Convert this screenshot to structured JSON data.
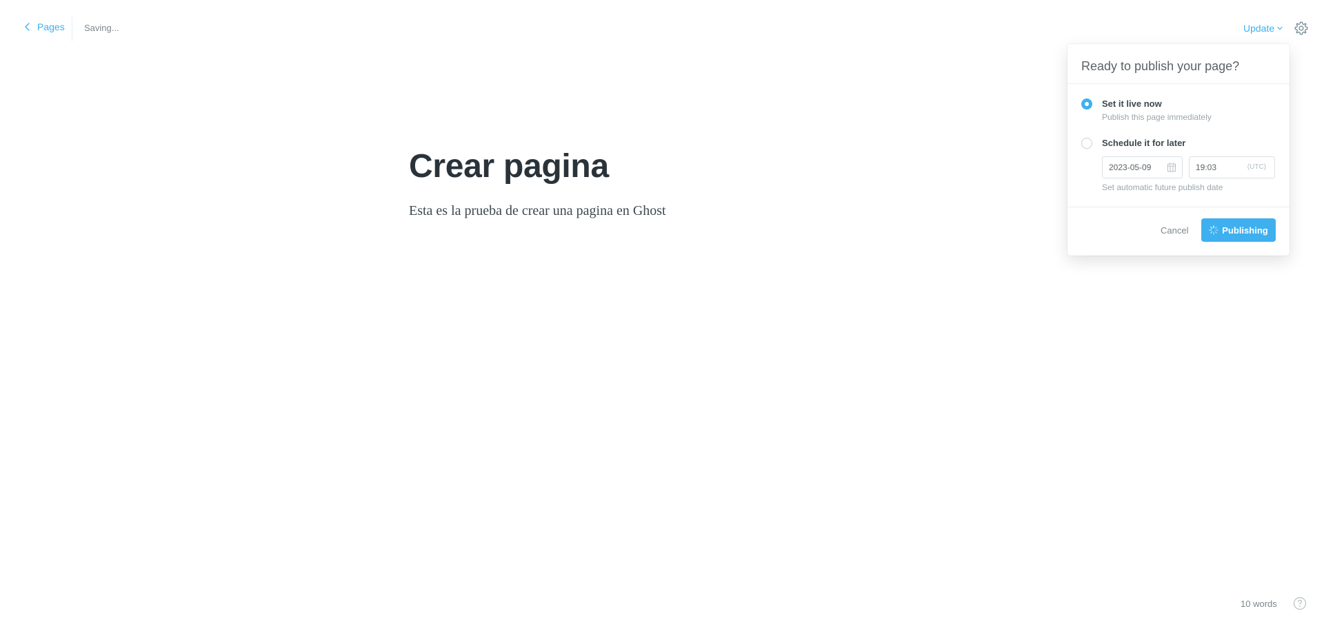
{
  "topbar": {
    "back_label": "Pages",
    "status": "Saving...",
    "update_label": "Update"
  },
  "editor": {
    "title": "Crear pagina",
    "body": "Esta es la prueba de crear una pagina en Ghost"
  },
  "publish_menu": {
    "header": "Ready to publish your page?",
    "options": [
      {
        "label": "Set it live now",
        "description": "Publish this page immediately",
        "selected": true
      },
      {
        "label": "Schedule it for later",
        "description": "Set automatic future publish date",
        "selected": false
      }
    ],
    "date_value": "2023-05-09",
    "time_value": "19:03",
    "timezone": "(UTC)",
    "cancel_label": "Cancel",
    "publish_label": "Publishing"
  },
  "footer": {
    "word_count": "10 words"
  },
  "icons": {
    "back": "chevron-left-icon",
    "update_caret": "chevron-down-icon",
    "settings": "gear-icon",
    "calendar": "calendar-icon",
    "spinner": "spinner-icon",
    "help": "help-circle-icon"
  },
  "colors": {
    "accent": "#3eb0ef",
    "text": "#15212a",
    "muted": "#7d878a"
  }
}
